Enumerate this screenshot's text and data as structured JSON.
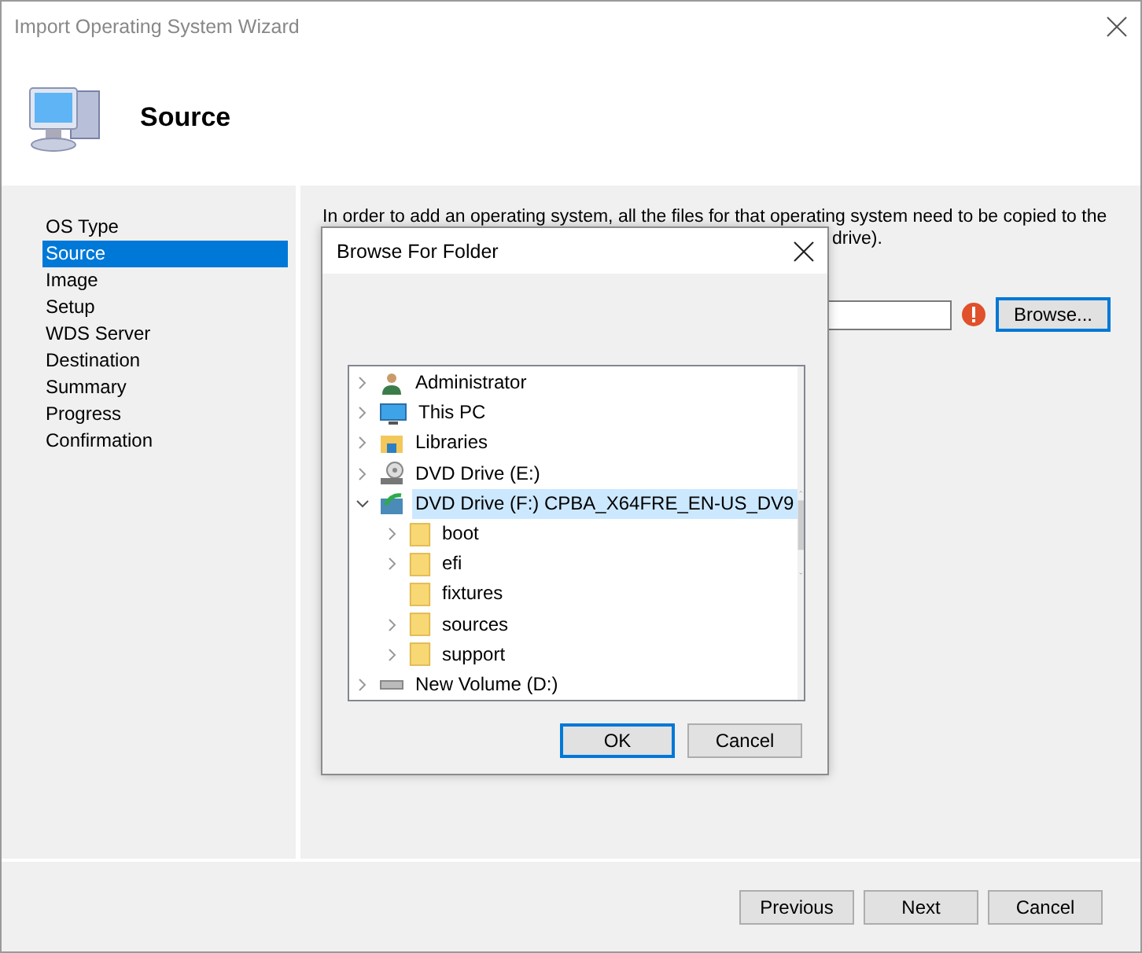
{
  "window": {
    "title": "Import Operating System Wizard"
  },
  "header": {
    "title": "Source"
  },
  "sidebar": {
    "items": [
      {
        "label": "OS Type",
        "selected": false
      },
      {
        "label": "Source",
        "selected": true
      },
      {
        "label": "Image",
        "selected": false
      },
      {
        "label": "Setup",
        "selected": false
      },
      {
        "label": "WDS Server",
        "selected": false
      },
      {
        "label": "Destination",
        "selected": false
      },
      {
        "label": "Summary",
        "selected": false
      },
      {
        "label": "Progress",
        "selected": false
      },
      {
        "label": "Confirmation",
        "selected": false
      }
    ]
  },
  "content": {
    "intro_line_1": "In order to add an operating system, all the files for that operating system need to be copied to the",
    "intro_line_2_visible": "drive).",
    "browse_button": "Browse...",
    "source_error": true
  },
  "dialog": {
    "title": "Browse For Folder",
    "tree": [
      {
        "label": "Administrator",
        "kind": "user",
        "expandable": true,
        "expanded": false,
        "selected": false
      },
      {
        "label": "This PC",
        "kind": "pc",
        "expandable": true,
        "expanded": false,
        "selected": false
      },
      {
        "label": "Libraries",
        "kind": "libraries",
        "expandable": true,
        "expanded": false,
        "selected": false
      },
      {
        "label": "DVD Drive (E:)",
        "kind": "dvd",
        "expandable": true,
        "expanded": false,
        "selected": false
      },
      {
        "label": "DVD Drive (F:) CPBA_X64FRE_EN-US_DV9",
        "kind": "dvd-media",
        "expandable": true,
        "expanded": true,
        "selected": true,
        "children": [
          {
            "label": "boot",
            "kind": "folder",
            "expandable": true,
            "expanded": false,
            "selected": false
          },
          {
            "label": "efi",
            "kind": "folder",
            "expandable": true,
            "expanded": false,
            "selected": false
          },
          {
            "label": "fixtures",
            "kind": "folder",
            "expandable": false,
            "expanded": false,
            "selected": false
          },
          {
            "label": "sources",
            "kind": "folder",
            "expandable": true,
            "expanded": false,
            "selected": false
          },
          {
            "label": "support",
            "kind": "folder",
            "expandable": true,
            "expanded": false,
            "selected": false
          }
        ]
      },
      {
        "label": "New Volume (D:)",
        "kind": "drive",
        "expandable": true,
        "expanded": false,
        "selected": false
      }
    ],
    "buttons": [
      {
        "label": "OK",
        "default": true
      },
      {
        "label": "Cancel",
        "default": false
      }
    ]
  },
  "footer": {
    "buttons": [
      {
        "label": "Previous"
      },
      {
        "label": "Next"
      },
      {
        "label": "Cancel"
      }
    ]
  }
}
